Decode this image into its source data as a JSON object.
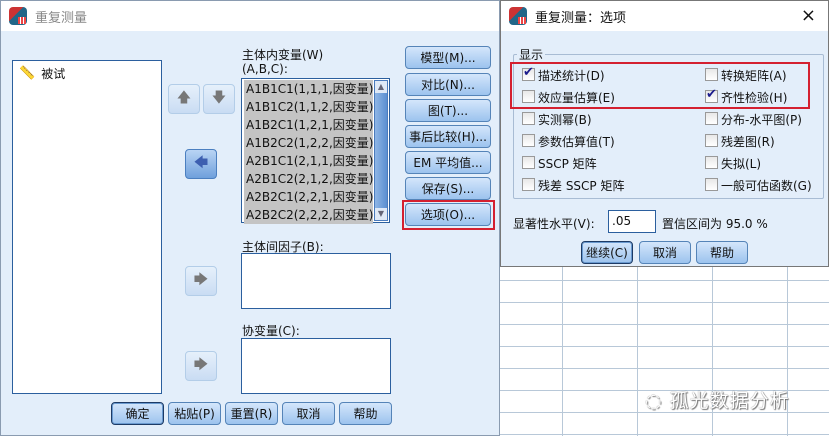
{
  "main_dialog": {
    "title": "重复测量",
    "source_vars": [
      "被试"
    ],
    "within_label": "主体内变量(W)",
    "within_factors": "(A,B,C):",
    "within_items": [
      "A1B1C1(1,1,1,因变量)",
      "A1B1C2(1,1,2,因变量)",
      "A1B2C1(1,2,1,因变量)",
      "A1B2C2(1,2,2,因变量)",
      "A2B1C1(2,1,1,因变量)",
      "A2B1C2(2,1,2,因变量)",
      "A2B2C1(2,2,1,因变量)",
      "A2B2C2(2,2,2,因变量)"
    ],
    "between_label": "主体间因子(B):",
    "covariate_label": "协变量(C):",
    "side_buttons": [
      "模型(M)...",
      "对比(N)...",
      "图(T)...",
      "事后比较(H)...",
      "EM 平均值...",
      "保存(S)...",
      "选项(O)..."
    ],
    "bottom_buttons": [
      "确定",
      "粘贴(P)",
      "重置(R)",
      "取消",
      "帮助"
    ]
  },
  "options_dialog": {
    "title": "重复测量：选项",
    "close": "×",
    "group_label": "显示",
    "checkboxes_left": [
      {
        "label": "描述统计(D)",
        "checked": true
      },
      {
        "label": "效应量估算(E)",
        "checked": false
      },
      {
        "label": "实测幂(B)",
        "checked": false
      },
      {
        "label": "参数估算值(T)",
        "checked": false
      },
      {
        "label": "SSCP 矩阵",
        "checked": false
      },
      {
        "label": "残差 SSCP 矩阵",
        "checked": false
      }
    ],
    "checkboxes_right": [
      {
        "label": "转换矩阵(A)",
        "checked": false
      },
      {
        "label": "齐性检验(H)",
        "checked": true
      },
      {
        "label": "分布-水平图(P)",
        "checked": false
      },
      {
        "label": "残差图(R)",
        "checked": false
      },
      {
        "label": "失拟(L)",
        "checked": false
      },
      {
        "label": "一般可估函数(G)",
        "checked": false
      }
    ],
    "sig_label": "显著性水平(V):",
    "sig_value": ".05",
    "ci_text": "置信区间为 95.0 %",
    "buttons": [
      "继续(C)",
      "取消",
      "帮助"
    ]
  },
  "watermark": "孤光数据分析"
}
